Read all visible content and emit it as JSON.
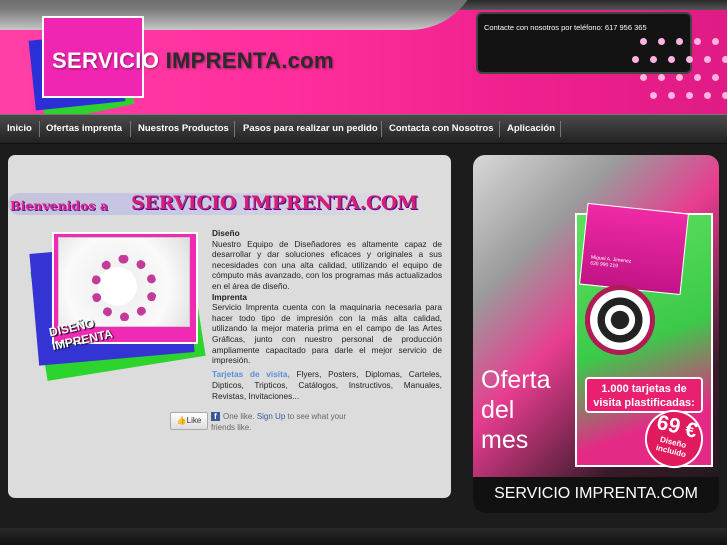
{
  "header": {
    "brand_part1": "SERVICIO",
    "brand_part2": "IMPRENTA.com",
    "contact_text": "Contacte con nosotros por teléfono: 617 956 365"
  },
  "nav": {
    "items": [
      "Inicio",
      "Ofertas imprenta",
      "Nuestros Productos",
      "Pasos para realizar un pedido",
      "Contacta con Nosotros",
      "Aplicación"
    ]
  },
  "welcome": {
    "prefix": "Bienvenidos a",
    "brand": "SERVICIO IMPRENTA.COM"
  },
  "design_image": {
    "label_line1": "DISEÑO",
    "label_line2": "IMPRENTA"
  },
  "content": {
    "diseno_title": "Diseño",
    "diseno_text": "Nuestro Equipo de Diseñadores es altamente capaz de desarrollar y dar soluciones eficaces y originales a sus necesidades con una alta calidad, utilizando el equipo de cómputo más avanzado, con los programas más actualizados en el área de diseño.",
    "imprenta_title": "Imprenta",
    "imprenta_text": "Servicio Imprenta cuenta con la maquinaria necesaria para hacer todo tipo de impresión con la más alta calidad, utilizando la mejor materia prima en el campo de las Artes Gráficas, junto con nuestro personal de producción ampliamente capacitado para darle el mejor servicio de impresión.",
    "products_link": "Tarjetas de visita,",
    "products_text": " Flyers, Posters, Diplomas, Carteles, Dipticos, Tripticos, Catálogos, Instructivos, Manuales, Revistas, Invitaciones..."
  },
  "facebook": {
    "like_label": "Like",
    "icon": "f",
    "text_before": "One like.",
    "signup": "Sign Up",
    "text_after": "to see what your friends like."
  },
  "promo": {
    "offer_line1": "Oferta",
    "offer_line2": "del",
    "offer_line3": "mes",
    "price_text": "1.000 tarjetas de visita plastificadas:",
    "price": "69 €",
    "sticker_text": "Diseño incluido",
    "card_name": "Miguel A. Jimenez",
    "card_phone": "630 990 219",
    "footer": "SERVICIO IMPRENTA.COM"
  }
}
